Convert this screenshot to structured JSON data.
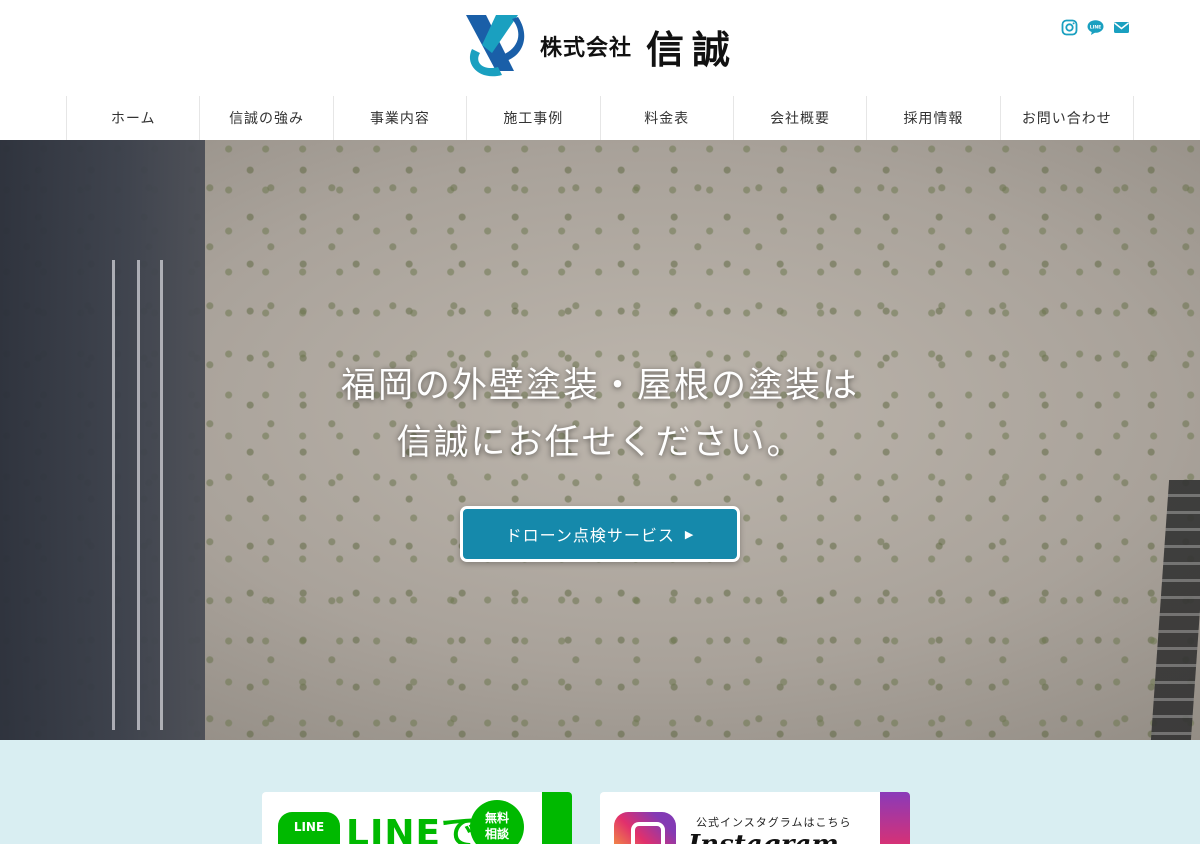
{
  "header": {
    "logo_sub": "株式会社",
    "logo_main": "信誠",
    "social_icons": [
      "instagram-icon",
      "line-icon",
      "mail-icon"
    ],
    "accent_color": "#1aa0c0"
  },
  "nav": {
    "items": [
      "ホーム",
      "信誠の強み",
      "事業内容",
      "施工事例",
      "料金表",
      "会社概要",
      "採用情報",
      "お問い合わせ"
    ]
  },
  "hero": {
    "line1": "福岡の外壁塗装・屋根の塗装は",
    "line2": "信誠にお任せください。",
    "button_label": "ドローン点検サービス",
    "button_arrow": "▶",
    "button_color": "#1589ab"
  },
  "banners": {
    "line": {
      "icon_text": "LINE",
      "text": "LINEで",
      "badge_line1": "無料",
      "badge_line2": "相談"
    },
    "instagram": {
      "top_text": "公式インスタグラムはこちら",
      "word": "Instagram"
    },
    "background_color": "#d9eef2"
  }
}
